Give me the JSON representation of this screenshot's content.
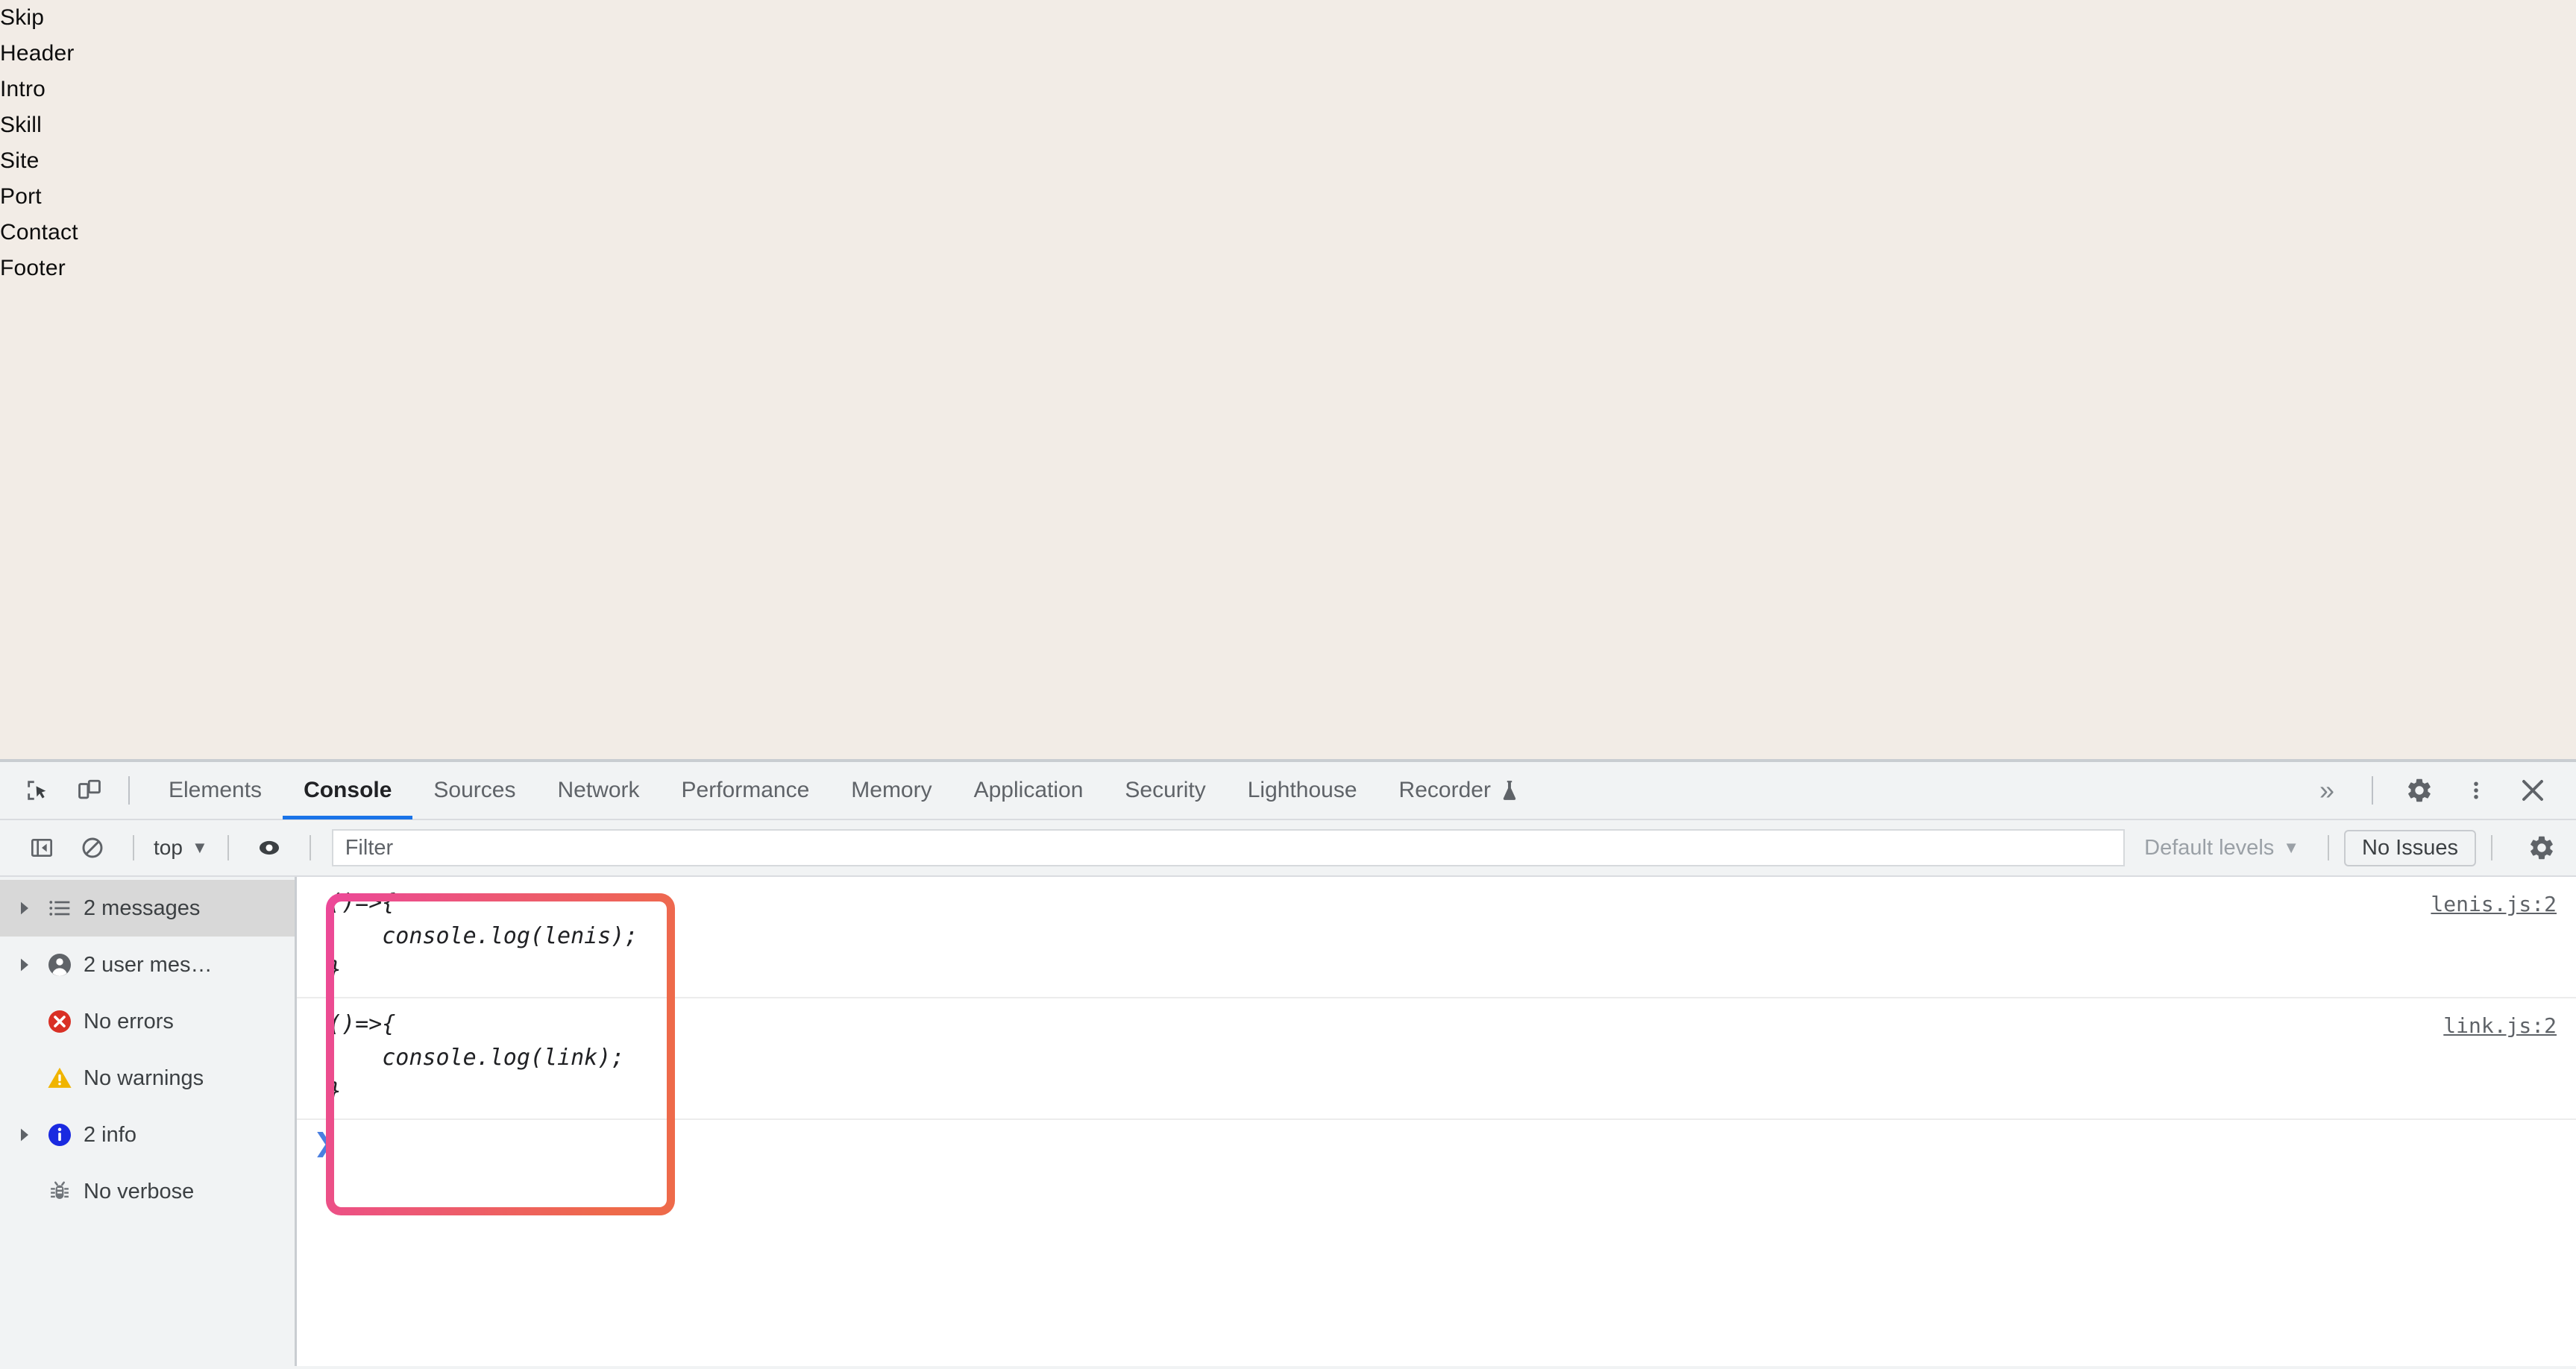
{
  "page": {
    "background_color": "#f2ece6",
    "nav_items": [
      "Skip",
      "Header",
      "Intro",
      "Skill",
      "Site",
      "Port",
      "Contact",
      "Footer"
    ]
  },
  "devtools": {
    "toolbar": {
      "inspect_icon": "inspect-element-icon",
      "device_icon": "device-toolbar-icon",
      "tabs": [
        {
          "label": "Elements",
          "active": false
        },
        {
          "label": "Console",
          "active": true
        },
        {
          "label": "Sources",
          "active": false
        },
        {
          "label": "Network",
          "active": false
        },
        {
          "label": "Performance",
          "active": false
        },
        {
          "label": "Memory",
          "active": false
        },
        {
          "label": "Application",
          "active": false
        },
        {
          "label": "Security",
          "active": false
        },
        {
          "label": "Lighthouse",
          "active": false
        },
        {
          "label": "Recorder",
          "active": false,
          "badge": "flask-icon"
        }
      ],
      "more_tabs_label": "»",
      "settings_icon": "gear-icon",
      "more_options_icon": "kebab-menu-icon",
      "close_icon": "close-icon",
      "active_tab_underline_color": "#1a73e8"
    },
    "console_toolbar": {
      "sidebar_toggle_icon": "show-console-sidebar-icon",
      "clear_icon": "clear-console-icon",
      "context_label": "top",
      "context_caret": "▼",
      "live_expression_icon": "eye-icon",
      "filter_placeholder": "Filter",
      "filter_value": "",
      "levels_label": "Default levels",
      "levels_caret": "▼",
      "issues_label": "No Issues",
      "settings_icon": "gear-icon"
    },
    "sidebar": {
      "items": [
        {
          "label": "2 messages",
          "icon": "list-icon",
          "expandable": true,
          "selected": true
        },
        {
          "label": "2 user mes…",
          "icon": "user-icon",
          "expandable": true,
          "selected": false
        },
        {
          "label": "No errors",
          "icon": "error-icon",
          "expandable": false,
          "selected": false
        },
        {
          "label": "No warnings",
          "icon": "warning-icon",
          "expandable": false,
          "selected": false
        },
        {
          "label": "2 info",
          "icon": "info-icon",
          "expandable": true,
          "selected": false
        },
        {
          "label": "No verbose",
          "icon": "bug-icon",
          "expandable": false,
          "selected": false
        }
      ],
      "icon_colors": {
        "error": "#d93025",
        "warning": "#f0b400",
        "info": "#1a2ae0",
        "bug": "#70757a",
        "list": "#5f6368",
        "user": "#5f6368"
      }
    },
    "console_messages": [
      {
        "code": "()=>{\n    console.log(lenis);\n}",
        "source": "lenis.js:2"
      },
      {
        "code": "()=>{\n    console.log(link);\n}",
        "source": "link.js:2"
      }
    ],
    "prompt": {
      "chevron": "❯"
    }
  },
  "annotation": {
    "highlight_box": {
      "gradient_start": "#ec4899",
      "gradient_end": "#ee6a4a",
      "shape": "rounded-rectangle-outline"
    }
  }
}
